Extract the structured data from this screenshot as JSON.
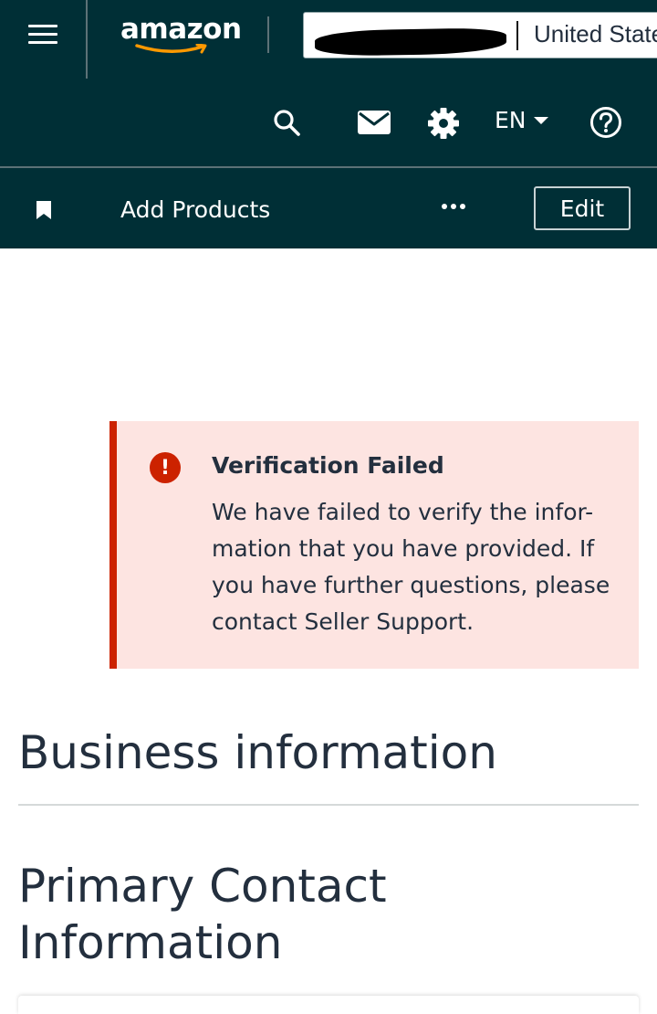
{
  "header": {
    "logo_text": "amazon",
    "store": {
      "name_redacted": "",
      "country": "United States"
    },
    "icons": [
      "menu-icon",
      "search-icon",
      "mail-icon",
      "gear-icon",
      "help-icon"
    ],
    "language": "EN"
  },
  "toolbar": {
    "bookmark_label": "Add Products",
    "edit_label": "Edit"
  },
  "alert": {
    "title": "Verification Failed",
    "body": "We have failed to verify the infor-mation that you have provided. If you have further questions, please contact Seller Support.",
    "icon": "!",
    "color": "#cc2200"
  },
  "sections": {
    "business_heading": "Business information",
    "contact_heading": "Primary Contact Information"
  },
  "colors": {
    "header_bg": "#002f36",
    "alert_bg": "#fde4e1"
  }
}
